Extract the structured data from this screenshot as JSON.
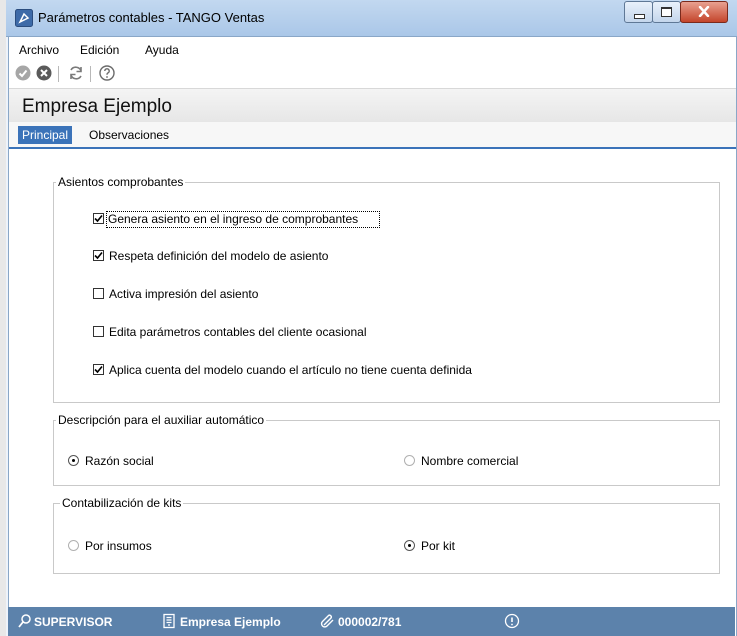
{
  "window": {
    "title": "Parámetros contables - TANGO Ventas",
    "icon": "tango-icon"
  },
  "menu": {
    "items": [
      {
        "label": "Archivo"
      },
      {
        "label": "Edición"
      },
      {
        "label": "Ayuda"
      }
    ]
  },
  "toolbar": {
    "buttons": [
      "accept-icon",
      "cancel-icon",
      "refresh-icon",
      "help-icon"
    ]
  },
  "company": "Empresa Ejemplo",
  "tabs": [
    {
      "label": "Principal",
      "active": true
    },
    {
      "label": "Observaciones",
      "active": false
    }
  ],
  "groups": {
    "asientos": {
      "title": "Asientos comprobantes",
      "options": [
        {
          "label": "Genera asiento en el ingreso de comprobantes",
          "checked": true
        },
        {
          "label": "Respeta definición del modelo de asiento",
          "checked": true
        },
        {
          "label": "Activa impresión del asiento",
          "checked": false
        },
        {
          "label": "Edita parámetros contables del cliente ocasional",
          "checked": false
        },
        {
          "label": "Aplica cuenta del modelo cuando el artículo no tiene cuenta definida",
          "checked": true
        }
      ]
    },
    "descripcion": {
      "title": "Descripción para el auxiliar automático",
      "options": [
        {
          "label": "Razón social",
          "selected": true
        },
        {
          "label": "Nombre comercial",
          "selected": false
        }
      ]
    },
    "kits": {
      "title": "Contabilización de kits",
      "options": [
        {
          "label": "Por insumos",
          "selected": false
        },
        {
          "label": "Por kit",
          "selected": true
        }
      ]
    }
  },
  "statusbar": {
    "user": "SUPERVISOR",
    "company": "Empresa Ejemplo",
    "code": "000002/781"
  },
  "colors": {
    "accent": "#3b73b9",
    "status": "#5c82ab"
  }
}
